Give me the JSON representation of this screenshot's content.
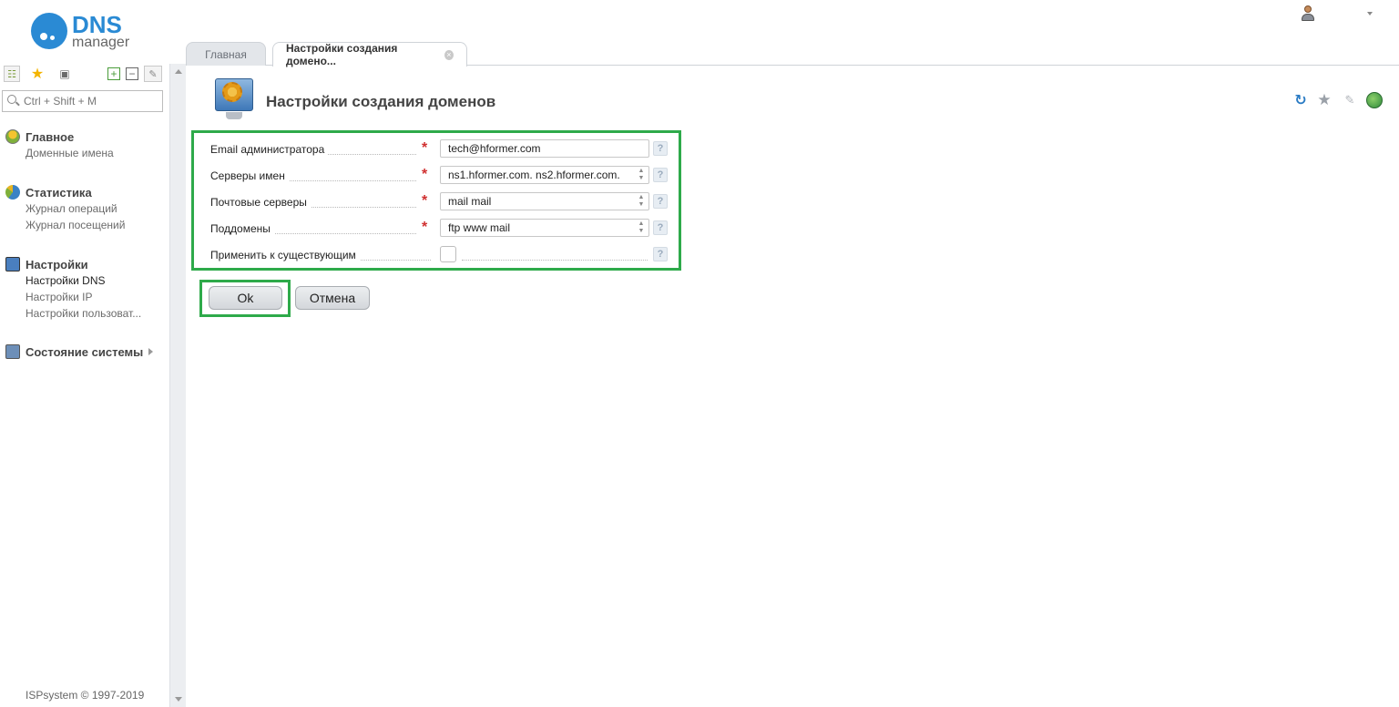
{
  "app": {
    "logo_dns": "DNS",
    "logo_manager": "manager"
  },
  "search": {
    "placeholder": "Ctrl + Shift + M"
  },
  "sidebar": {
    "groups": [
      {
        "title": "Главное",
        "items": [
          "Доменные имена"
        ]
      },
      {
        "title": "Статистика",
        "items": [
          "Журнал операций",
          "Журнал посещений"
        ]
      },
      {
        "title": "Настройки",
        "items": [
          "Настройки DNS",
          "Настройки IP",
          "Настройки пользоват..."
        ]
      },
      {
        "title": "Состояние системы",
        "items": []
      }
    ],
    "copyright": "ISPsystem © 1997-2019"
  },
  "tabs": [
    {
      "label": "Главная"
    },
    {
      "label": "Настройки создания домено..."
    }
  ],
  "page": {
    "title": "Настройки создания доменов"
  },
  "form": {
    "fields": [
      {
        "label": "Email администратора",
        "value": "tech@hformer.com",
        "required": true
      },
      {
        "label": "Серверы имен",
        "value": "ns1.hformer.com. ns2.hformer.com.",
        "required": true
      },
      {
        "label": "Почтовые серверы",
        "value": "mail mail",
        "required": true
      },
      {
        "label": "Поддомены",
        "value": "ftp www mail",
        "required": true
      },
      {
        "label": "Применить к существующим",
        "checked": false,
        "required": false
      }
    ],
    "required_mark": "*",
    "help_mark": "?"
  },
  "buttons": {
    "ok": "Ok",
    "cancel": "Отмена"
  },
  "colors": {
    "accent": "#2a8ad4",
    "highlight": "#2eaa4a",
    "required": "#d03030"
  }
}
